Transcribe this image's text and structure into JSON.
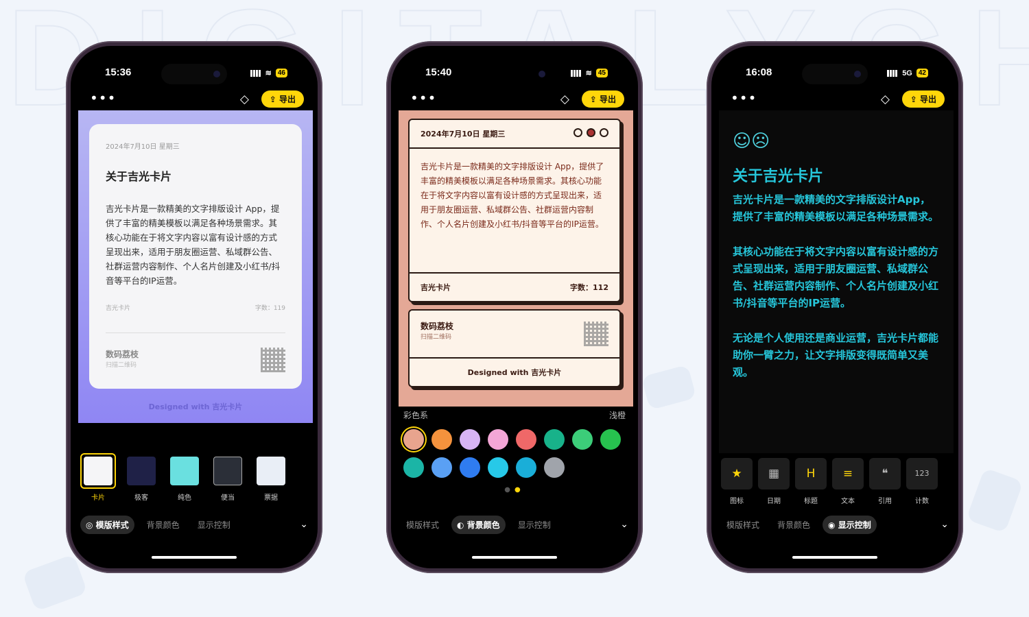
{
  "phones": [
    {
      "time": "15:36",
      "battery": "46",
      "network": "",
      "export_label": "导出",
      "card": {
        "date": "2024年7月10日 星期三",
        "title": "关于吉光卡片",
        "body": "吉光卡片是一款精美的文字排版设计 App，提供了丰富的精美模板以满足各种场景需求。其核心功能在于将文字内容以富有设计感的方式呈现出来，适用于朋友圈运营、私域群公告、社群运营内容制作、个人名片创建及小红书/抖音等平台的IP运营。",
        "footer_left": "吉光卡片",
        "footer_right": "字数：119",
        "brand": "数码荔枝",
        "scan": "扫描二维码",
        "designed": "Designed with 吉光卡片"
      },
      "templates": [
        {
          "label": "卡片",
          "selected": true,
          "color": "#f5f5f7"
        },
        {
          "label": "极客",
          "selected": false,
          "color": "#1f2147"
        },
        {
          "label": "纯色",
          "selected": false,
          "color": "#6ae0e0"
        },
        {
          "label": "便当",
          "selected": false,
          "color": "#2b2f38"
        },
        {
          "label": "票据",
          "selected": false,
          "color": "#e9eef6"
        }
      ],
      "tabs": [
        "模版样式",
        "背景颜色",
        "显示控制"
      ],
      "active_tab": 0
    },
    {
      "time": "15:40",
      "battery": "45",
      "network": "",
      "export_label": "导出",
      "card": {
        "date": "2024年7月10日 星期三",
        "body": "吉光卡片是一款精美的文字排版设计 App，提供了丰富的精美模板以满足各种场景需求。其核心功能在于将文字内容以富有设计感的方式呈现出来，适用于朋友圈运营、私域群公告、社群运营内容制作、个人名片创建及小红书/抖音等平台的IP运营。",
        "footer_left": "吉光卡片",
        "footer_right": "字数：112",
        "brand": "数码荔枝",
        "scan": "扫描二维码",
        "designed": "Designed with 吉光卡片"
      },
      "palette": {
        "title": "彩色系",
        "selected_name": "浅橙",
        "colors": [
          "#e8a48e",
          "#f4923d",
          "#d7b4f4",
          "#f3a6d6",
          "#ef6868",
          "#18b28a",
          "#3ccd79",
          "#27c24f",
          "#1bb5a6",
          "#5aa0f4",
          "#2f7cf0",
          "#27c9e8",
          "#1aaed8",
          "#a0a4ab"
        ]
      },
      "tabs": [
        "模版样式",
        "背景颜色",
        "显示控制"
      ],
      "active_tab": 1
    },
    {
      "time": "16:08",
      "battery": "42",
      "network": "5G",
      "export_label": "导出",
      "content": {
        "title": "关于吉光卡片",
        "para1": "吉光卡片是一款精美的文字排版设计App，提供了丰富的精美模板以满足各种场景需求。",
        "para2": "其核心功能在于将文字内容以富有设计感的方式呈现出来，适用于朋友圈运营、私域群公告、社群运营内容制作、个人名片创建及小红书/抖音等平台的IP运营。",
        "para3": "无论是个人使用还是商业运营，吉光卡片都能助你一臂之力，让文字排版变得既简单又美观。"
      },
      "tools": [
        {
          "label": "图标",
          "icon": "star-icon",
          "glyph": "★"
        },
        {
          "label": "日期",
          "icon": "calendar-icon",
          "glyph": "▦"
        },
        {
          "label": "标题",
          "icon": "heading-icon",
          "glyph": "H"
        },
        {
          "label": "文本",
          "icon": "text-icon",
          "glyph": "≡"
        },
        {
          "label": "引用",
          "icon": "quote-icon",
          "glyph": "❝"
        },
        {
          "label": "计数",
          "icon": "counter-icon",
          "glyph": "123"
        }
      ],
      "tabs": [
        "模版样式",
        "背景颜色",
        "显示控制"
      ],
      "active_tab": 2
    }
  ],
  "accent_color": "#ffd60a"
}
